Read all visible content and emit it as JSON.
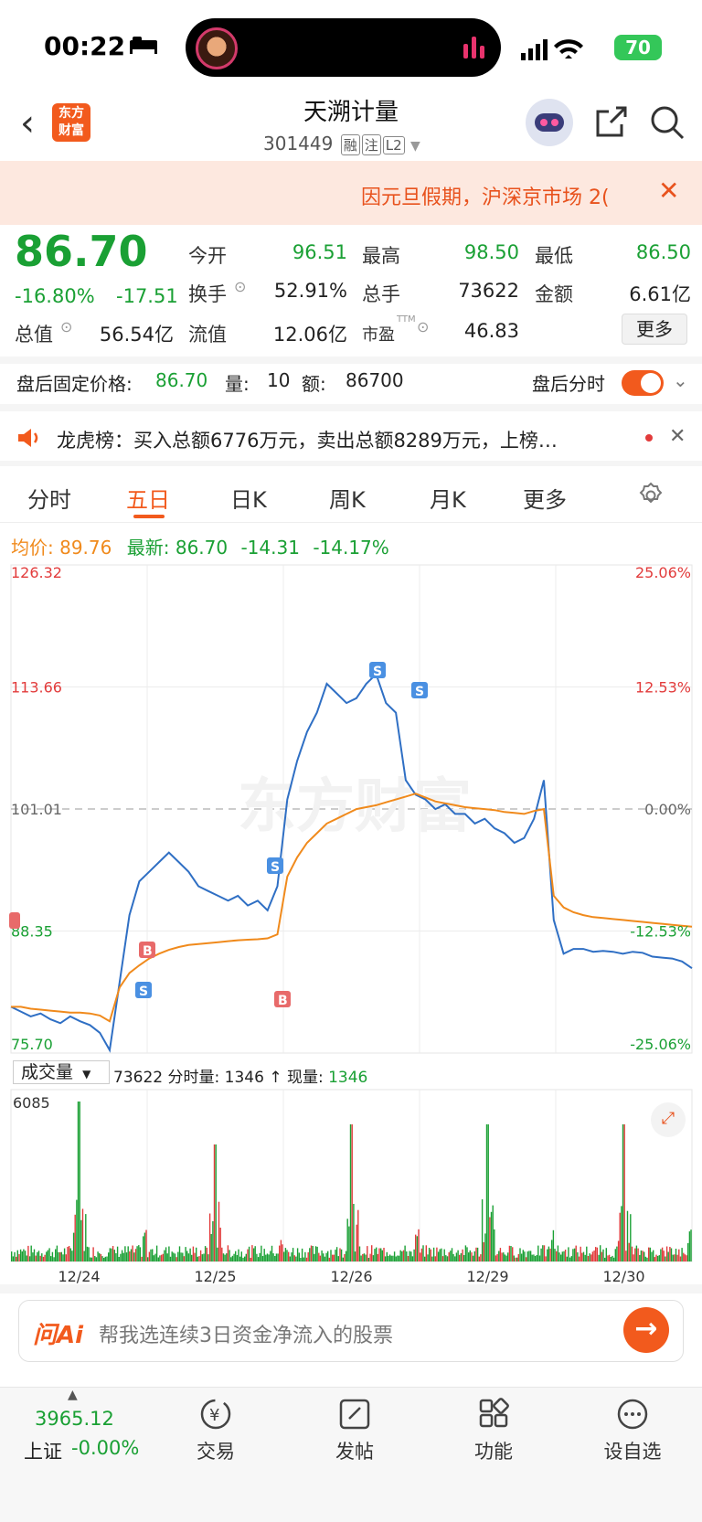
{
  "status_bar": {
    "time": "00:22",
    "battery": "70"
  },
  "header": {
    "title": "天溯计量",
    "code": "301449",
    "tags": [
      "融",
      "注",
      "L2"
    ]
  },
  "notice": {
    "text": "因元旦假期，沪深京市场 2("
  },
  "quote": {
    "price": "86.70",
    "change_pct": "-16.80%",
    "change_amt": "-17.51",
    "rows": [
      [
        {
          "label": "今开",
          "value": "96.51"
        },
        {
          "label": "最高",
          "value": "98.50"
        },
        {
          "label": "最低",
          "value": "86.50"
        }
      ],
      [
        {
          "label": "换手",
          "value": "52.91%"
        },
        {
          "label": "总手",
          "value": "73622"
        },
        {
          "label": "金额",
          "value": "6.61亿"
        }
      ],
      [
        {
          "label": "总值",
          "value": "56.54亿"
        },
        {
          "label": "流值",
          "value": "12.06亿"
        },
        {
          "label": "市盈",
          "value": "46.83"
        }
      ]
    ],
    "more": "更多"
  },
  "after_hours": {
    "label": "盘后固定价格:",
    "price": "86.70",
    "vol_label": "量:",
    "vol": "10",
    "amt_label": "额:",
    "amt": "86700",
    "time_label": "盘后分时"
  },
  "dragon_tiger": {
    "text": "龙虎榜：买入总额6776万元，卖出总额8289万元，上榜…"
  },
  "tabs": [
    "分时",
    "五日",
    "日K",
    "周K",
    "月K",
    "更多"
  ],
  "active_tab": "五日",
  "avg_row": {
    "avg_label": "均价:",
    "avg": "89.76",
    "latest_label": "最新:",
    "latest": "86.70",
    "chg": "-14.31",
    "pct": "-14.17%"
  },
  "chart_data": {
    "type": "line",
    "title": "",
    "x_dates": [
      "12/24",
      "12/25",
      "12/26",
      "12/29",
      "12/30"
    ],
    "y_left_ticks": [
      "126.32",
      "113.66",
      "101.01",
      "88.35",
      "75.70"
    ],
    "y_right_ticks": [
      "25.06%",
      "12.53%",
      "0.00%",
      "-12.53%",
      "-25.06%"
    ],
    "ylim": [
      75.7,
      126.32
    ],
    "prev_close": 101.01,
    "series": [
      {
        "color": "#2f6fc4",
        "values": [
          80.5,
          80,
          79.5,
          79.8,
          79.2,
          78.8,
          79.5,
          79,
          78.6,
          77.8,
          76,
          83,
          90,
          93.5,
          94.5,
          95.5,
          96.5,
          95.5,
          94.5,
          93,
          92.5,
          92,
          91.5,
          92,
          91,
          91.5,
          90.5,
          93,
          102,
          106,
          109,
          111,
          114,
          113,
          112,
          112.5,
          114,
          115,
          112,
          111,
          104,
          102.5,
          102,
          101,
          101.5,
          100.5,
          100.5,
          99.5,
          100,
          99,
          98.5,
          97.5,
          98,
          100,
          104,
          89.5,
          86,
          86.5,
          86.5,
          86.2,
          86.3,
          86.2,
          86,
          86.2,
          86.1,
          85.7,
          85.6,
          85.5,
          85.2,
          84.5
        ]
      },
      {
        "color": "#f08a1c",
        "values": [
          80.5,
          80.5,
          80.3,
          80.2,
          80.1,
          80,
          79.9,
          79.9,
          79.8,
          79.6,
          79,
          82.5,
          84,
          84.8,
          85.5,
          86,
          86.4,
          86.7,
          86.9,
          87,
          87.1,
          87.2,
          87.3,
          87.4,
          87.45,
          87.5,
          87.6,
          88,
          94,
          96,
          97.5,
          98.5,
          99.5,
          100,
          100.5,
          101,
          101.2,
          101.4,
          101.7,
          102,
          102.3,
          102.6,
          102.2,
          101.8,
          101.6,
          101.4,
          101.2,
          101.1,
          101,
          100.9,
          100.7,
          100.6,
          100.5,
          100.8,
          101,
          92,
          90.8,
          90.3,
          90,
          89.8,
          89.7,
          89.6,
          89.5,
          89.4,
          89.3,
          89.2,
          89.1,
          89,
          88.9,
          88.8
        ]
      }
    ]
  },
  "volume": {
    "label": "成交量",
    "total": "73622",
    "period_label": "分时量:",
    "period": "1346",
    "now_label": "现量:",
    "now": "1346",
    "max": "6085"
  },
  "ask_ai": {
    "logo": "问Ai",
    "placeholder": "帮我选连续3日资金净流入的股票"
  },
  "bottom_nav": {
    "index_value": "3965.12",
    "index_name": "上证",
    "index_change": "-0.00%",
    "items": [
      "交易",
      "发帖",
      "功能",
      "设自选"
    ]
  }
}
